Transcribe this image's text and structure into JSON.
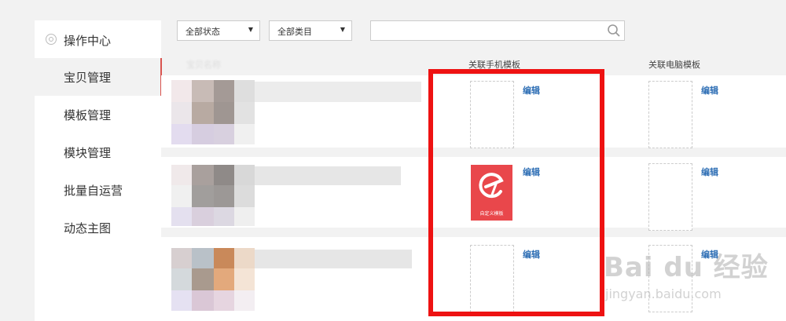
{
  "sidebar": {
    "title": "操作中心",
    "items": [
      {
        "label": "宝贝管理",
        "active": true
      },
      {
        "label": "模板管理",
        "active": false
      },
      {
        "label": "模块管理",
        "active": false
      },
      {
        "label": "批量自运营",
        "active": false
      },
      {
        "label": "动态主图",
        "active": false
      }
    ]
  },
  "filters": {
    "status": "全部状态",
    "category": "全部类目",
    "search_value": ""
  },
  "table": {
    "col_item": "宝贝名称",
    "col_mobile": "关联手机模板",
    "col_pc": "关联电脑模板",
    "rows": [
      {
        "mobile_edit": "编辑",
        "pc_edit": "编辑"
      },
      {
        "mobile_edit": "编辑",
        "pc_edit": "编辑"
      },
      {
        "mobile_edit": "编辑",
        "pc_edit": "编辑"
      }
    ],
    "app_caption": "自定义模板"
  },
  "watermark": {
    "main": "Bai du 经验",
    "url": "jingyan.baidu.com"
  },
  "colors": {
    "accent": "#d9534f",
    "highlight_box": "#ee1212",
    "link": "#2f6fb5",
    "app_icon": "#e9474b"
  }
}
